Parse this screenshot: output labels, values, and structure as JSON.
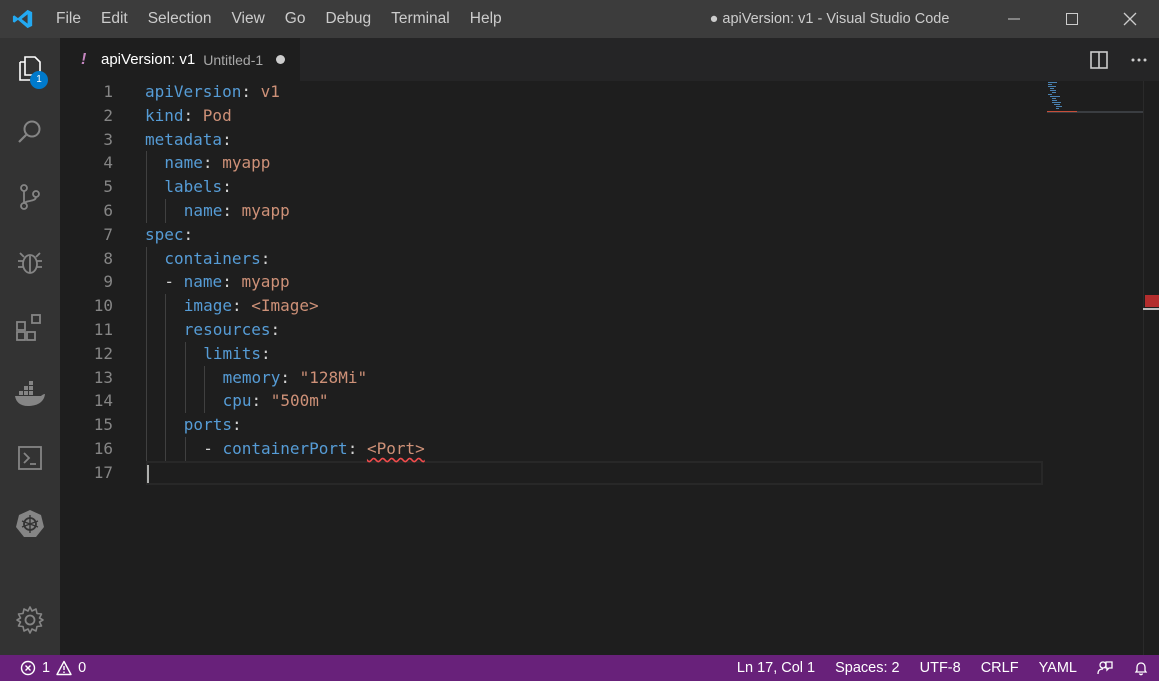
{
  "window": {
    "title": "apiVersion: v1 - Visual Studio Code"
  },
  "menu": [
    "File",
    "Edit",
    "Selection",
    "View",
    "Go",
    "Debug",
    "Terminal",
    "Help"
  ],
  "activity_bar": {
    "explorer_badge": "1",
    "items": [
      "explorer-icon",
      "search-icon",
      "source-control-icon",
      "debug-icon",
      "extensions-icon",
      "docker-icon",
      "terminal-icon",
      "kubernetes-icon",
      "settings-gear-icon"
    ]
  },
  "tab": {
    "marker": "!",
    "name": "apiVersion: v1",
    "description": "Untitled-1"
  },
  "editor": {
    "lines": [
      {
        "n": "1",
        "indent": 0,
        "dash": "",
        "key": "apiVersion",
        "value": "v1"
      },
      {
        "n": "2",
        "indent": 0,
        "dash": "",
        "key": "kind",
        "value": "Pod"
      },
      {
        "n": "3",
        "indent": 0,
        "dash": "",
        "key": "metadata",
        "value": ""
      },
      {
        "n": "4",
        "indent": 1,
        "dash": "",
        "key": "name",
        "value": "myapp"
      },
      {
        "n": "5",
        "indent": 1,
        "dash": "",
        "key": "labels",
        "value": ""
      },
      {
        "n": "6",
        "indent": 2,
        "dash": "",
        "key": "name",
        "value": "myapp"
      },
      {
        "n": "7",
        "indent": 0,
        "dash": "",
        "key": "spec",
        "value": ""
      },
      {
        "n": "8",
        "indent": 1,
        "dash": "",
        "key": "containers",
        "value": ""
      },
      {
        "n": "9",
        "indent": 1,
        "dash": "- ",
        "key": "name",
        "value": "myapp"
      },
      {
        "n": "10",
        "indent": 2,
        "dash": "",
        "key": "image",
        "value": "<Image>"
      },
      {
        "n": "11",
        "indent": 2,
        "dash": "",
        "key": "resources",
        "value": ""
      },
      {
        "n": "12",
        "indent": 3,
        "dash": "",
        "key": "limits",
        "value": ""
      },
      {
        "n": "13",
        "indent": 4,
        "dash": "",
        "key": "memory",
        "value": "\"128Mi\""
      },
      {
        "n": "14",
        "indent": 4,
        "dash": "",
        "key": "cpu",
        "value": "\"500m\""
      },
      {
        "n": "15",
        "indent": 2,
        "dash": "",
        "key": "ports",
        "value": ""
      },
      {
        "n": "16",
        "indent": 3,
        "dash": "- ",
        "key": "containerPort",
        "value": "<Port>",
        "error": true
      },
      {
        "n": "17",
        "indent": 0,
        "dash": "",
        "key": "",
        "value": ""
      }
    ]
  },
  "statusbar": {
    "errors": "1",
    "warnings": "0",
    "position": "Ln 17, Col 1",
    "spaces": "Spaces: 2",
    "encoding": "UTF-8",
    "eol": "CRLF",
    "language": "YAML"
  },
  "colors": {
    "statusbar": "#68217a",
    "accent": "#007acc",
    "key": "#569cd6",
    "string": "#ce9178"
  }
}
